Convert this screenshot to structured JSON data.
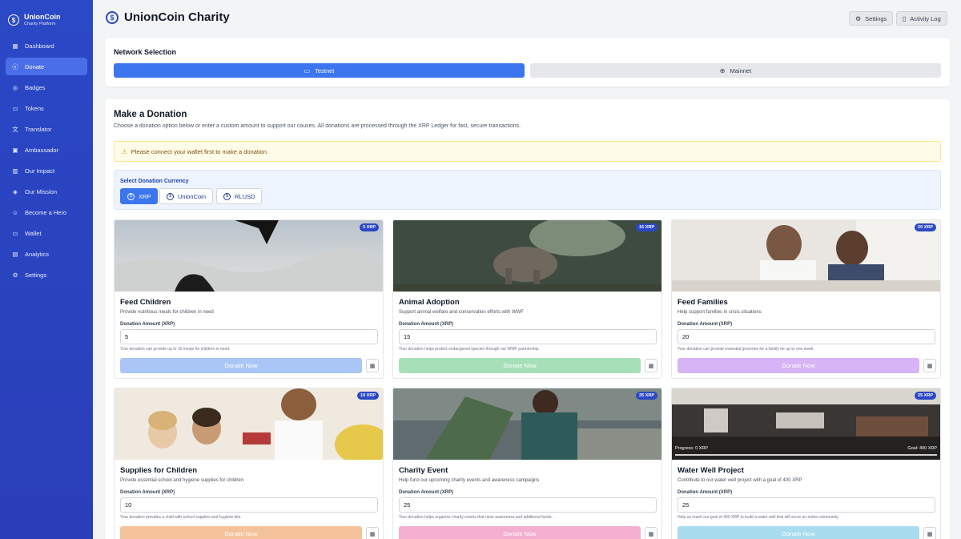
{
  "brand": {
    "name": "UnionCoin",
    "subtitle": "Charity Platform"
  },
  "sidebar": {
    "items": [
      {
        "label": "Dashboard",
        "icon": "grid-icon"
      },
      {
        "label": "Donate",
        "icon": "dollar-circle-icon",
        "active": true
      },
      {
        "label": "Badges",
        "icon": "badge-icon"
      },
      {
        "label": "Tokens",
        "icon": "tokens-icon"
      },
      {
        "label": "Translator",
        "icon": "translate-icon"
      },
      {
        "label": "Ambassador",
        "icon": "ambassador-icon"
      },
      {
        "label": "Our Impact",
        "icon": "chart-icon"
      },
      {
        "label": "Our Mission",
        "icon": "mission-icon"
      },
      {
        "label": "Become a Hero",
        "icon": "hero-icon"
      },
      {
        "label": "Wallet",
        "icon": "wallet-icon"
      },
      {
        "label": "Analytics",
        "icon": "analytics-icon"
      },
      {
        "label": "Settings",
        "icon": "gear-icon"
      }
    ]
  },
  "header": {
    "title": "UnionCoin Charity",
    "settings_label": "Settings",
    "activity_label": "Activity Log"
  },
  "network": {
    "title": "Network Selection",
    "testnet_label": "Testnet",
    "mainnet_label": "Mainnet",
    "selected": "Testnet"
  },
  "donate": {
    "title": "Make a Donation",
    "description": "Choose a donation option below or enter a custom amount to support our causes. All donations are processed through the XRP Ledger for fast, secure transactions.",
    "warning": "Please connect your wallet first to make a donation.",
    "currency_label": "Select Donation Currency",
    "currencies": [
      "XRP",
      "UnionCoin",
      "RLUSD"
    ],
    "selected_currency": "XRP",
    "amount_label": "Donation Amount (XRP)",
    "button_label": "Donate Now"
  },
  "causes": [
    {
      "title": "Feed Children",
      "description": "Provide nutritious meals for children in need",
      "badge": "5 XRP",
      "amount": "5",
      "note": "Your donation can provide up to 10 meals for children in need.",
      "color": "#aac6f7"
    },
    {
      "title": "Animal Adoption",
      "description": "Support animal welfare and conservation efforts with WWF",
      "badge": "15 XRP",
      "amount": "15",
      "note": "Your donation helps protect endangered species through our WWF partnership.",
      "color": "#a7e0b8"
    },
    {
      "title": "Feed Families",
      "description": "Help support families in crisis situations",
      "badge": "20 XRP",
      "amount": "20",
      "note": "Your donation can provide essential groceries for a family for up to one week.",
      "color": "#d6b4f5"
    },
    {
      "title": "Supplies for Children",
      "description": "Provide essential school and hygiene supplies for children",
      "badge": "10 XRP",
      "amount": "10",
      "note": "Your donation provides a child with school supplies and hygiene kits.",
      "color": "#f4c39c"
    },
    {
      "title": "Charity Event",
      "description": "Help fund our upcoming charity events and awareness campaigns",
      "badge": "25 XRP",
      "amount": "25",
      "note": "Your donation helps organize charity events that raise awareness and additional funds.",
      "color": "#f3afd0"
    },
    {
      "title": "Water Well Project",
      "description": "Contribute to our water well project with a goal of 400 XRP",
      "badge": "25 XRP",
      "amount": "25",
      "note": "Help us reach our goal of 400 XRP to build a water well that will serve an entire community.",
      "color": "#a9dcee",
      "progress_label": "Progress: 0 XRP",
      "goal_label": "Goal: 400 XRP",
      "progress": 0
    }
  ]
}
